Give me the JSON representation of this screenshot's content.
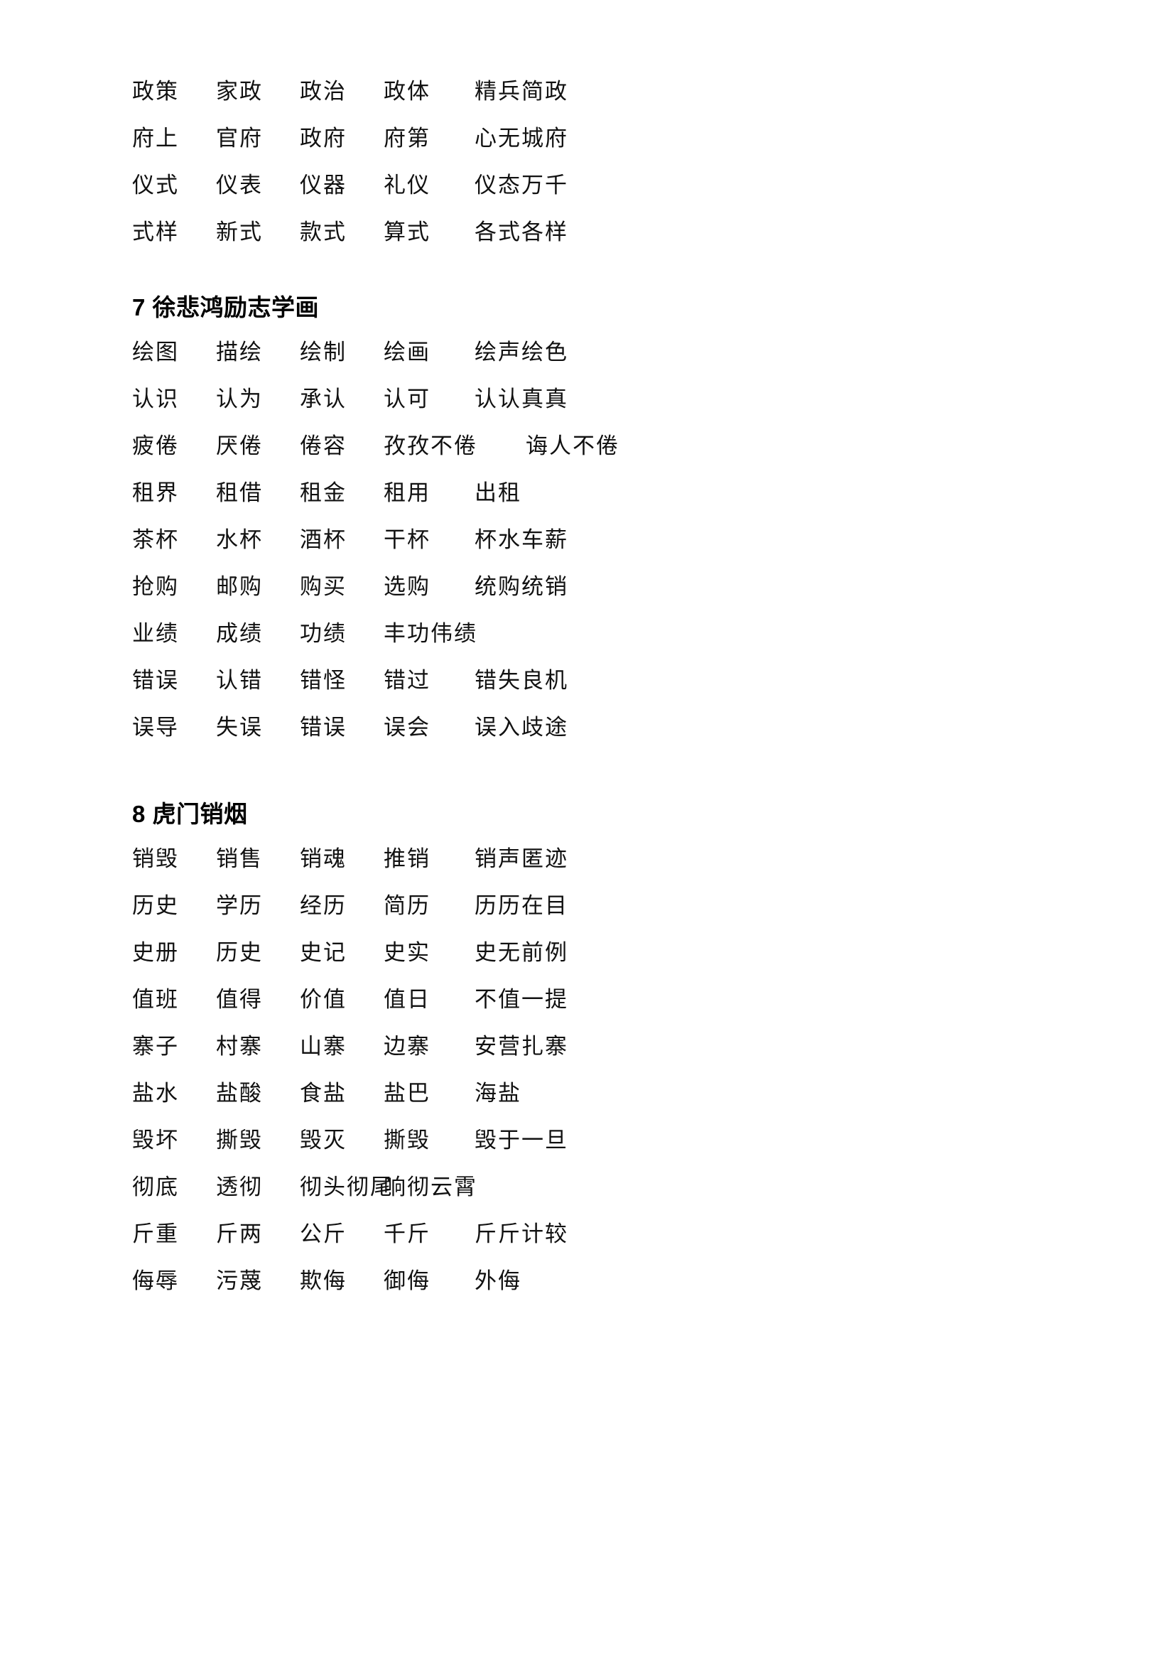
{
  "document": {
    "page_background": "#ffffff",
    "text_color": "#000000",
    "blocks": [
      {
        "id": "block-continuation",
        "heading": "",
        "rows": [
          {
            "cells": [
              "政策",
              "家政",
              "政治",
              "政体",
              "精兵简政"
            ]
          },
          {
            "cells": [
              "府上",
              "官府",
              "政府",
              "府第",
              "心无城府"
            ]
          },
          {
            "cells": [
              "仪式",
              "仪表",
              "仪器",
              "礼仪",
              "仪态万千"
            ]
          },
          {
            "cells": [
              "式样",
              "新式",
              "款式",
              "算式",
              "各式各样"
            ]
          }
        ]
      },
      {
        "id": "block-7",
        "heading": "7 徐悲鸿励志学画",
        "heading_number": "7",
        "heading_title": "徐悲鸿励志学画",
        "rows": [
          {
            "cells": [
              "绘图",
              "描绘",
              "绘制",
              "绘画",
              "绘声绘色"
            ]
          },
          {
            "cells": [
              "认识",
              "认为",
              "承认",
              "认可",
              "认认真真"
            ]
          },
          {
            "cells": [
              "疲倦",
              "厌倦",
              "倦容",
              "孜孜不倦",
              "诲人不倦"
            ],
            "wide": true
          },
          {
            "cells": [
              "租界",
              "租借",
              "租金",
              "租用",
              "出租"
            ]
          },
          {
            "cells": [
              "茶杯",
              "水杯",
              "酒杯",
              "干杯",
              "杯水车薪"
            ]
          },
          {
            "cells": [
              "抢购",
              "邮购",
              "购买",
              "选购",
              "统购统销"
            ]
          },
          {
            "cells": [
              "业绩",
              "成绩",
              "功绩",
              "丰功伟绩",
              ""
            ]
          },
          {
            "cells": [
              "错误",
              "认错",
              "错怪",
              "错过",
              "错失良机"
            ]
          },
          {
            "cells": [
              "误导",
              "失误",
              "错误",
              "误会",
              "误入歧途"
            ]
          }
        ]
      },
      {
        "id": "block-8",
        "heading": "8 虎门销烟",
        "heading_number": "8",
        "heading_title": "虎门销烟",
        "rows": [
          {
            "cells": [
              "销毁",
              "销售",
              "销魂",
              "推销",
              "销声匿迹"
            ]
          },
          {
            "cells": [
              "历史",
              "学历",
              "经历",
              "简历",
              "历历在目"
            ]
          },
          {
            "cells": [
              "史册",
              "历史",
              "史记",
              "史实",
              "史无前例"
            ]
          },
          {
            "cells": [
              "值班",
              "值得",
              "价值",
              "值日",
              "不值一提"
            ]
          },
          {
            "cells": [
              "寨子",
              "村寨",
              "山寨",
              "边寨",
              "安营扎寨"
            ]
          },
          {
            "cells": [
              "盐水",
              "盐酸",
              "食盐",
              "盐巴",
              "海盐"
            ]
          },
          {
            "cells": [
              "毁坏",
              "撕毁",
              "毁灭",
              "撕毁",
              "毁于一旦"
            ]
          },
          {
            "cells": [
              "彻底",
              "透彻",
              "彻头彻尾",
              "响彻云霄",
              ""
            ],
            "wide": true
          },
          {
            "cells": [
              "斤重",
              "斤两",
              "公斤",
              "千斤",
              "斤斤计较"
            ]
          },
          {
            "cells": [
              "侮辱",
              "污蔑",
              "欺侮",
              "御侮",
              "外侮"
            ]
          }
        ]
      }
    ]
  }
}
